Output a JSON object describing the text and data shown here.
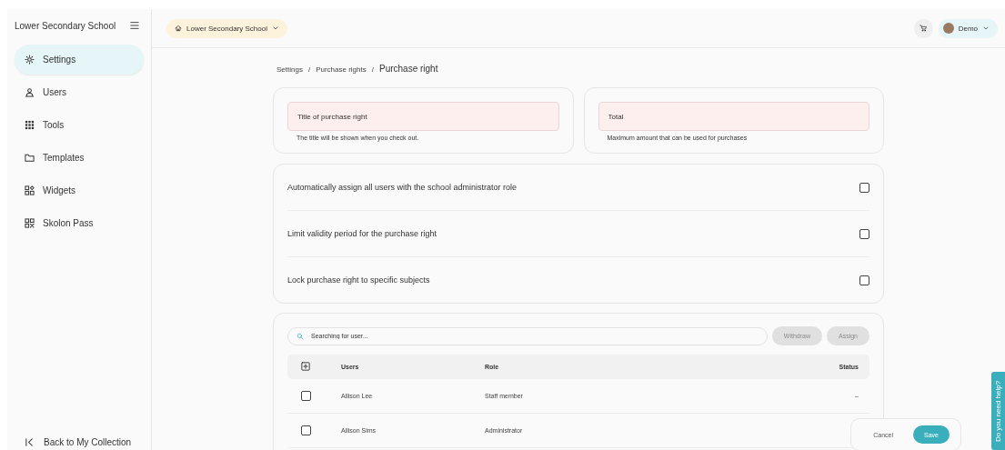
{
  "sidebar": {
    "title": "Lower Secondary School",
    "items": [
      {
        "label": "Settings",
        "selected": true
      },
      {
        "label": "Users",
        "selected": false
      },
      {
        "label": "Tools",
        "selected": false
      },
      {
        "label": "Templates",
        "selected": false
      },
      {
        "label": "Widgets",
        "selected": false
      },
      {
        "label": "Skolon Pass",
        "selected": false
      }
    ],
    "back_link": "Back to My Collection"
  },
  "header": {
    "school_selector": "Lower Secondary School",
    "user_menu": "Demo"
  },
  "breadcrumb": {
    "separator": "/",
    "items": [
      {
        "label": "Settings"
      },
      {
        "label": "Purchase rights"
      },
      {
        "label": "Purchase right"
      }
    ]
  },
  "fields": [
    {
      "placeholder": "Title of purchase right",
      "hint": "The title will be shown when you check out."
    },
    {
      "placeholder": "Total",
      "hint": "Maximum amount that can be used for purchases"
    }
  ],
  "options": [
    {
      "label": "Automatically assign all users with the school administrator role",
      "checked": false
    },
    {
      "label": "Limit validity period for the purchase right",
      "checked": false
    },
    {
      "label": "Lock purchase right to specific subjects",
      "checked": false
    }
  ],
  "users": {
    "search": {
      "placeholder": "Searching for user..."
    },
    "buttons": [
      {
        "label": "Withdraw",
        "disabled": true
      },
      {
        "label": "Assign",
        "disabled": true
      }
    ],
    "columns": [
      "Users",
      "Role",
      "Status"
    ],
    "rows": [
      {
        "user": "Allison Lee",
        "role": "Staff member",
        "status": "–",
        "checked": false
      },
      {
        "user": "Allison Sims",
        "role": "Administrator",
        "checked": false
      }
    ]
  },
  "footer_buttons": [
    {
      "label": "Cancel",
      "kind": "secondary"
    },
    {
      "label": "Save",
      "kind": "primary"
    }
  ],
  "help_tab": "Do you need help?"
}
